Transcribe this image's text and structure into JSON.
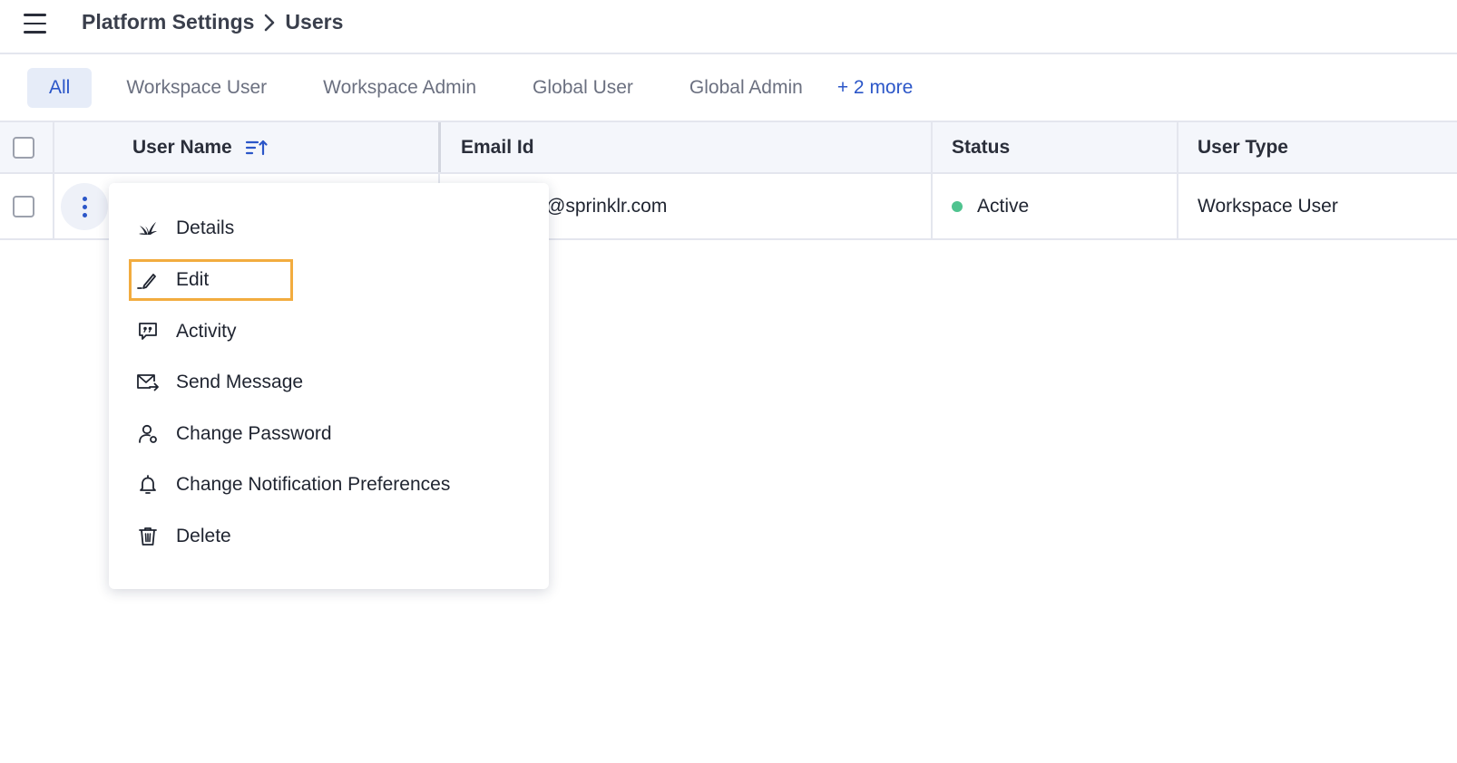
{
  "header": {
    "menu_icon": "hamburger-icon",
    "breadcrumb": [
      "Platform Settings",
      "Users"
    ]
  },
  "tabs": [
    {
      "label": "All",
      "active": true
    },
    {
      "label": "Workspace User",
      "active": false
    },
    {
      "label": "Workspace Admin",
      "active": false
    },
    {
      "label": "Global User",
      "active": false
    },
    {
      "label": "Global Admin",
      "active": false
    }
  ],
  "tabs_more": "+ 2 more",
  "table": {
    "columns": [
      "User Name",
      "Email Id",
      "Status",
      "User Type"
    ],
    "rows": [
      {
        "email": "@sprinklr.com",
        "status": "Active",
        "user_type": "Workspace User"
      }
    ]
  },
  "menu": {
    "items": [
      {
        "label": "Details",
        "icon": "sprinklr-logo-icon"
      },
      {
        "label": "Edit",
        "icon": "pencil-icon",
        "highlighted": true
      },
      {
        "label": "Activity",
        "icon": "quote-bubble-icon"
      },
      {
        "label": "Send Message",
        "icon": "envelope-forward-icon"
      },
      {
        "label": "Change Password",
        "icon": "user-key-icon"
      },
      {
        "label": "Change Notification Preferences",
        "icon": "bell-icon"
      },
      {
        "label": "Delete",
        "icon": "trash-icon"
      }
    ]
  },
  "colors": {
    "accent": "#2b56c8",
    "active_tab_bg": "#e6ecf8",
    "status_active": "#4fc38f",
    "highlight_border": "#f2ac3f"
  }
}
